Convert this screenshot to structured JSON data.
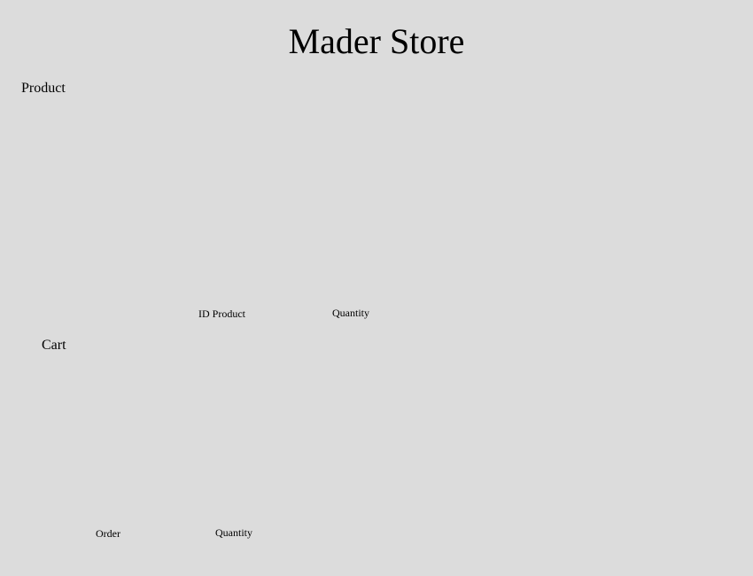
{
  "app": {
    "title": "Mader Store"
  },
  "product_section": {
    "label": "Product",
    "id_product_label": "ID Product",
    "quantity_label": "Quantity"
  },
  "cart_section": {
    "label": "Cart",
    "order_label": "Order",
    "quantity_label": "Quantity"
  }
}
